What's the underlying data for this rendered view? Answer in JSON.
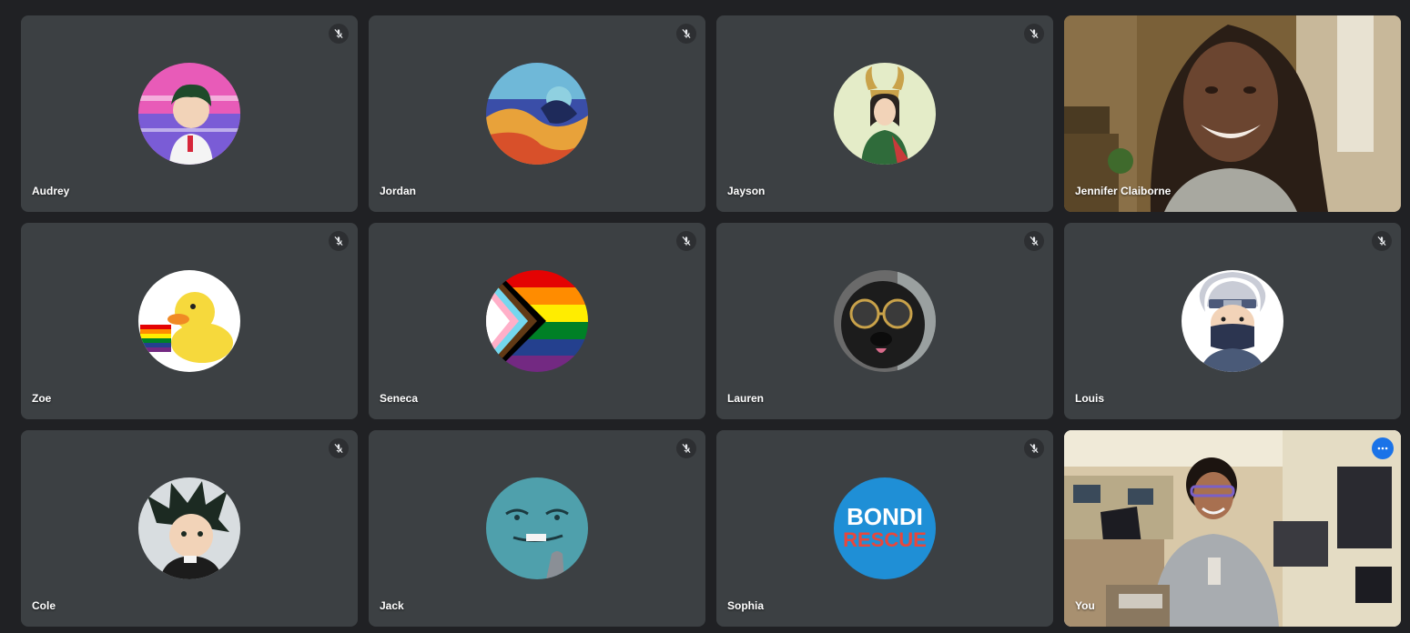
{
  "participants": [
    {
      "name": "Audrey",
      "muted": true,
      "kind": "avatar",
      "avatar_colors": [
        "#e85bb8",
        "#7a5cd6",
        "#2f6e3c"
      ]
    },
    {
      "name": "Jordan",
      "muted": true,
      "kind": "avatar",
      "avatar_colors": [
        "#3a4ea8",
        "#e8a23a",
        "#8fd0e0"
      ]
    },
    {
      "name": "Jayson",
      "muted": true,
      "kind": "avatar",
      "avatar_colors": [
        "#e4ecc8",
        "#2f6b3a",
        "#c9a24a"
      ]
    },
    {
      "name": "Jennifer Claiborne",
      "muted": false,
      "kind": "video"
    },
    {
      "name": "Zoe",
      "muted": true,
      "kind": "avatar",
      "avatar_colors": [
        "#ffffff",
        "#f6d93c",
        "#e8473c"
      ]
    },
    {
      "name": "Seneca",
      "muted": true,
      "kind": "avatar",
      "avatar_colors": [
        "#e40303",
        "#ff8c00",
        "#ffed00",
        "#008026",
        "#24408e",
        "#732982"
      ]
    },
    {
      "name": "Lauren",
      "muted": true,
      "kind": "avatar",
      "avatar_colors": [
        "#3a3a3a",
        "#1c1c1c",
        "#c9a24a"
      ]
    },
    {
      "name": "Louis",
      "muted": true,
      "kind": "avatar",
      "avatar_colors": [
        "#ffffff",
        "#c9ccd6",
        "#2c3550"
      ]
    },
    {
      "name": "Cole",
      "muted": true,
      "kind": "avatar",
      "avatar_colors": [
        "#d8dde0",
        "#1c2a22",
        "#f2d3b8"
      ]
    },
    {
      "name": "Jack",
      "muted": true,
      "kind": "avatar",
      "avatar_colors": [
        "#4fa0ac",
        "#2c6b76",
        "#8a8f96"
      ]
    },
    {
      "name": "Sophia",
      "muted": true,
      "kind": "avatar",
      "avatar_text_1": "BONDI",
      "avatar_text_2": "RESCUE",
      "avatar_colors": [
        "#1f8fd6",
        "#e8473c",
        "#ffffff"
      ]
    },
    {
      "name": "You",
      "muted": false,
      "kind": "self-video"
    }
  ],
  "colors": {
    "background": "#202124",
    "tile": "#3c4043",
    "self_border": "#8ab4f8",
    "more_button": "#1a73e8"
  }
}
